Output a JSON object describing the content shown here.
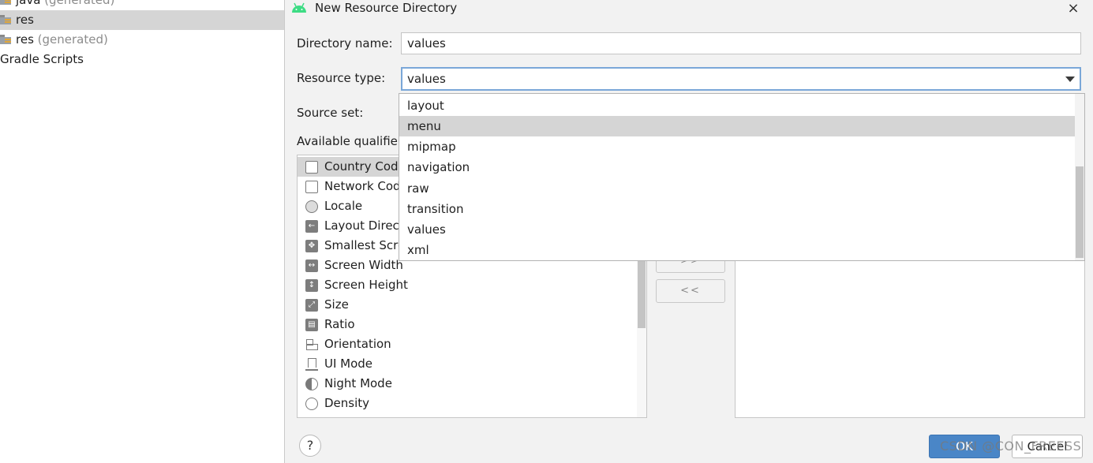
{
  "project_tree": {
    "items": [
      {
        "name": "java",
        "suffix": " (generated)"
      },
      {
        "name": "res",
        "suffix": ""
      },
      {
        "name": "res",
        "suffix": " (generated)"
      },
      {
        "name": "Gradle Scripts",
        "suffix": ""
      }
    ]
  },
  "dialog": {
    "title": "New Resource Directory",
    "close_icon": "×",
    "directory_name_label": "Directory name:",
    "directory_name_value": "values",
    "resource_type_label": "Resource type:",
    "resource_type_value": "values",
    "source_set_label": "Source set:",
    "available_qualifiers_label": "Available qualifier",
    "qualifiers": [
      {
        "label": "Country Code",
        "icon": "sim-icon"
      },
      {
        "label": "Network Code",
        "icon": "sim-icon"
      },
      {
        "label": "Locale",
        "icon": "globe-icon"
      },
      {
        "label": "Layout Direction",
        "icon": "arrow-left-icon"
      },
      {
        "label": "Smallest Screen",
        "icon": "resize-all-icon"
      },
      {
        "label": "Screen Width",
        "icon": "width-icon"
      },
      {
        "label": "Screen Height",
        "icon": "height-icon"
      },
      {
        "label": "Size",
        "icon": "diagonal-resize-icon"
      },
      {
        "label": "Ratio",
        "icon": "ratio-icon"
      },
      {
        "label": "Orientation",
        "icon": "orientation-icon"
      },
      {
        "label": "UI Mode",
        "icon": "monitor-icon"
      },
      {
        "label": "Night Mode",
        "icon": "moon-icon"
      },
      {
        "label": "Density",
        "icon": "density-icon"
      }
    ],
    "add_button": ">>",
    "remove_button": "<<",
    "help_icon": "?",
    "ok_label": "OK",
    "cancel_label": "Cancel"
  },
  "resource_type_dropdown": {
    "options": [
      "layout",
      "menu",
      "mipmap",
      "navigation",
      "raw",
      "transition",
      "values",
      "xml"
    ],
    "hovered": "menu"
  },
  "watermark": "CSDN @CON_FREESS",
  "colors": {
    "accent": "#4a86c7",
    "selection": "#d5d5d5",
    "dialog_bg": "#f2f2f2",
    "android_green": "#3ddc84"
  }
}
